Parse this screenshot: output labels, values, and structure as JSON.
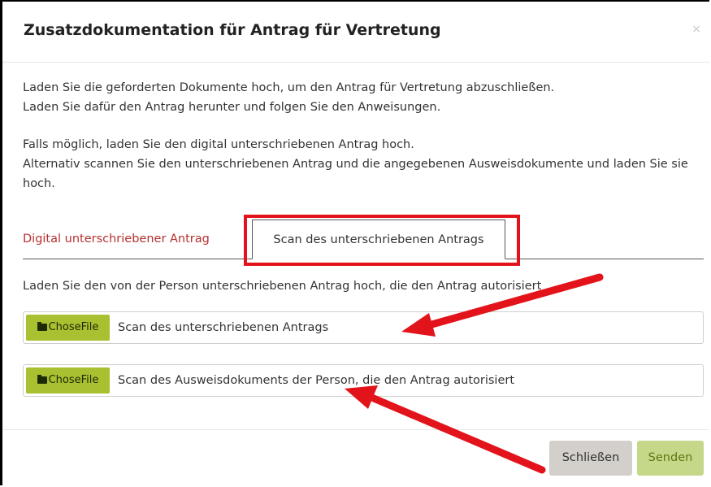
{
  "modal": {
    "title": "Zusatzdokumentation für Antrag für Vertretung",
    "close_icon": "×"
  },
  "intro": {
    "line1": "Laden Sie die geforderten Dokumente hoch, um den Antrag für Vertretung abzuschließen.",
    "line2": "Laden Sie dafür den Antrag herunter und folgen Sie den Anweisungen.",
    "line3": "Falls möglich, laden Sie den digital unterschriebenen Antrag hoch.",
    "line4": "Alternativ scannen Sie den unterschriebenen Antrag und die angegebenen Ausweisdokumente und laden Sie sie hoch."
  },
  "tabs": [
    {
      "label": "Digital unterschriebener Antrag",
      "active": false
    },
    {
      "label": "Scan des unterschriebenen Antrags",
      "active": true
    }
  ],
  "tab_content": {
    "instruction": "Laden Sie den von der Person unterschriebenen Antrag hoch, die den Antrag autorisiert",
    "uploads": [
      {
        "button_label": "ChoseFile",
        "icon": "folder-open-icon",
        "file_label": "Scan des unterschriebenen Antrags"
      },
      {
        "button_label": "ChoseFile",
        "icon": "folder-open-icon",
        "file_label": "Scan des Ausweisdokuments der Person, die den Antrag autorisiert"
      }
    ]
  },
  "footer": {
    "close_label": "Schließen",
    "send_label": "Senden"
  },
  "colors": {
    "annotation": "#e3131b",
    "file_button": "#a9c030",
    "send_button": "#c5d88a",
    "close_button": "#d3d0cc",
    "inactive_tab_text": "#b5302f"
  }
}
